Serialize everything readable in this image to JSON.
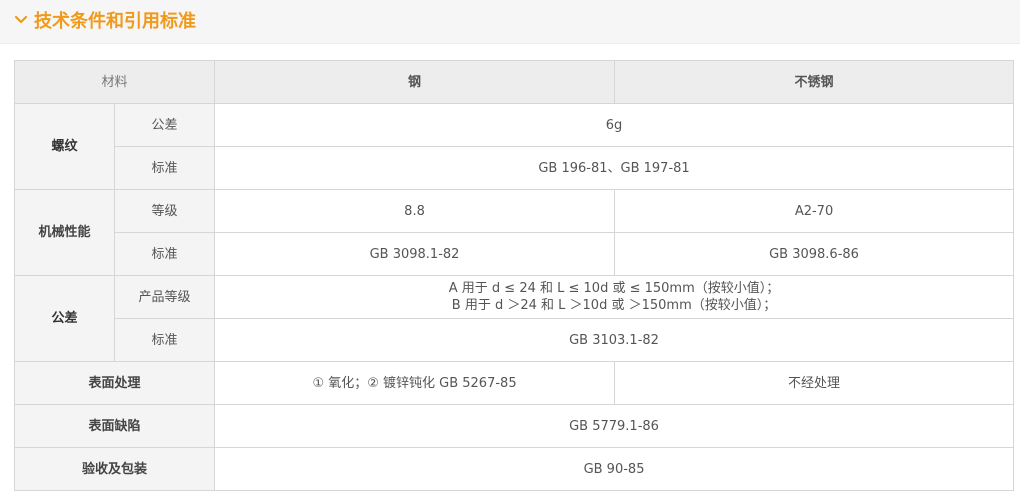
{
  "section": {
    "title": "技术条件和引用标准",
    "icon": "chevron-down-icon",
    "accent": "#f09a1d"
  },
  "table": {
    "header": {
      "material": "材料",
      "steel": "钢",
      "stainless": "不锈钢"
    },
    "thread": {
      "label": "螺纹",
      "tolerance_label": "公差",
      "tolerance_value": "6g",
      "standard_label": "标准",
      "standard_value": "GB 196-81、GB 197-81"
    },
    "mechanical": {
      "label": "机械性能",
      "grade_label": "等级",
      "grade_steel": "8.8",
      "grade_stainless": "A2-70",
      "standard_label": "标准",
      "standard_steel": "GB 3098.1-82",
      "standard_stainless": "GB 3098.6-86"
    },
    "tolerance": {
      "label": "公差",
      "product_grade_label": "产品等级",
      "product_grade_line1": "A 用于 d ≤ 24 和 L ≤ 10d 或 ≤ 150mm（按较小值）；",
      "product_grade_line2": "B 用于 d ＞24 和 L ＞10d 或 ＞150mm（按较小值）；",
      "standard_label": "标准",
      "standard_value": "GB 3103.1-82"
    },
    "surface_treatment": {
      "label": "表面处理",
      "steel": "① 氧化；② 镀锌钝化 GB 5267-85",
      "stainless": "不经处理"
    },
    "surface_defects": {
      "label": "表面缺陷",
      "value": "GB 5779.1-86"
    },
    "acceptance": {
      "label": "验收及包装",
      "value": "GB 90-85"
    }
  }
}
